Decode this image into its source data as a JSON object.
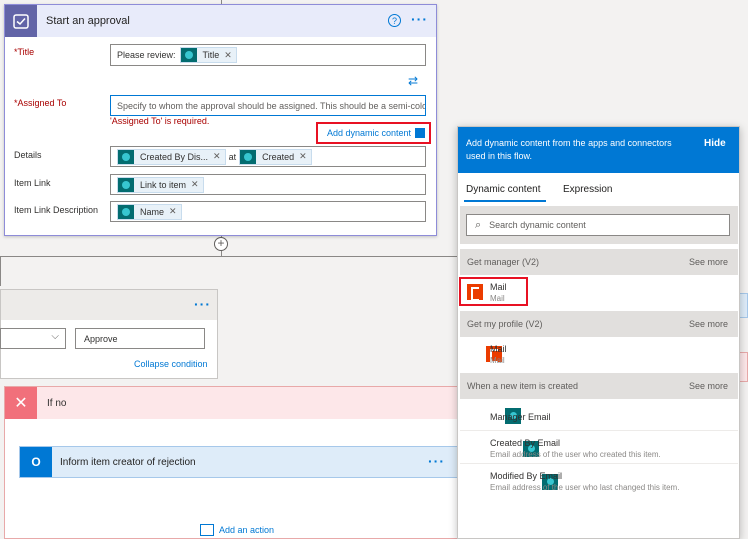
{
  "approval": {
    "title": "Start an approval",
    "help_icon": "?",
    "more": "···",
    "title_label": "*Title",
    "title_prefix": "Please review:",
    "title_token": "Title",
    "assigned_label": "*Assigned To",
    "assigned_placeholder": "Specify to whom the approval should be assigned. This should be a semi-color",
    "assigned_error": "'Assigned To' is required.",
    "add_dynamic": "Add dynamic content",
    "details_label": "Details",
    "details_token1": "Created By Dis...",
    "details_at": "at",
    "details_token2": "Created",
    "item_link_label": "Item Link",
    "item_link_token": "Link to item",
    "item_link_desc_label": "Item Link Description",
    "item_link_desc_token": "Name"
  },
  "condition": {
    "more": "···",
    "value": "Approve",
    "collapse": "Collapse condition"
  },
  "ifno": {
    "label": "If no",
    "action_title": "Inform item creator of rejection",
    "more": "···",
    "add_action": "Add an action"
  },
  "dynamic_panel": {
    "header": "Add dynamic content from the apps and connectors used in this flow.",
    "hide": "Hide",
    "tab_dynamic": "Dynamic content",
    "tab_expression": "Expression",
    "search_placeholder": "Search dynamic content",
    "sections": [
      {
        "title": "Get manager (V2)",
        "see_more": "See more",
        "items": [
          {
            "name": "Mail",
            "sub": "Mail",
            "icon": "office-icon"
          }
        ]
      },
      {
        "title": "Get my profile (V2)",
        "see_more": "See more",
        "items": [
          {
            "name": "Mail",
            "sub": "Mail",
            "icon": "office-icon"
          }
        ]
      },
      {
        "title": "When a new item is created",
        "see_more": "See more",
        "items": [
          {
            "name": "Manager Email",
            "sub": "",
            "icon": "sharepoint-icon"
          },
          {
            "name": "Created By Email",
            "sub": "Email address of the user who created this item.",
            "icon": "sharepoint-icon"
          },
          {
            "name": "Modified By Email",
            "sub": "Email address of the user who last changed this item.",
            "icon": "sharepoint-icon"
          }
        ]
      }
    ]
  },
  "colors": {
    "accent": "#0078d4",
    "approval_header": "#e8ebfa",
    "error": "#a80000",
    "highlight": "#e81123"
  }
}
